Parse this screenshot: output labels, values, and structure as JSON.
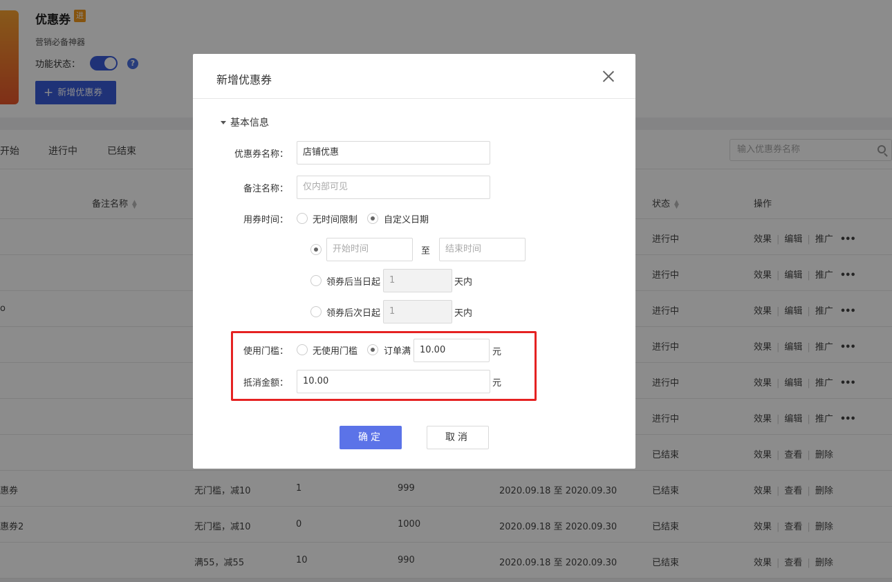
{
  "app": {
    "title": "优惠券",
    "badge": "进",
    "subtitle": "营销必备神器",
    "status_label": "功能状态：",
    "help": "?",
    "add_button": "新增优惠券"
  },
  "tabs": [
    "开始",
    "进行中",
    "已结束"
  ],
  "search": {
    "placeholder": "输入优惠券名称"
  },
  "table": {
    "headers": {
      "remark": "备注名称",
      "status": "状态",
      "ops": "操作"
    },
    "rows": [
      {
        "name": "",
        "cond": "",
        "a": "",
        "b": "",
        "period": "",
        "status": "进行中",
        "ops": [
          "效果",
          "编辑",
          "推广"
        ],
        "more": true
      },
      {
        "name": "",
        "cond": "",
        "a": "",
        "b": "",
        "period": "",
        "status": "进行中",
        "ops": [
          "效果",
          "编辑",
          "推广"
        ],
        "more": true
      },
      {
        "name": "o",
        "cond": "",
        "a": "",
        "b": "",
        "period": "",
        "status": "进行中",
        "ops": [
          "效果",
          "编辑",
          "推广"
        ],
        "more": true
      },
      {
        "name": "",
        "cond": "",
        "a": "",
        "b": "",
        "period": "",
        "status": "进行中",
        "ops": [
          "效果",
          "编辑",
          "推广"
        ],
        "more": true
      },
      {
        "name": "",
        "cond": "",
        "a": "",
        "b": "",
        "period": "",
        "status": "进行中",
        "ops": [
          "效果",
          "编辑",
          "推广"
        ],
        "more": true
      },
      {
        "name": "",
        "cond": "",
        "a": "",
        "b": "",
        "period": "",
        "status": "进行中",
        "ops": [
          "效果",
          "编辑",
          "推广"
        ],
        "more": true
      },
      {
        "name": "",
        "cond": "",
        "a": "",
        "b": "",
        "period": "",
        "status": "已结束",
        "ops": [
          "效果",
          "查看",
          "删除"
        ],
        "more": false
      },
      {
        "name": "惠券",
        "cond": "无门槛，减10",
        "a": "1",
        "b": "999",
        "period": "2020.09.18 至 2020.09.30",
        "status": "已结束",
        "ops": [
          "效果",
          "查看",
          "删除"
        ],
        "more": false
      },
      {
        "name": "惠券2",
        "cond": "无门槛，减10",
        "a": "0",
        "b": "1000",
        "period": "2020.09.18 至 2020.09.30",
        "status": "已结束",
        "ops": [
          "效果",
          "查看",
          "删除"
        ],
        "more": false
      },
      {
        "name": "",
        "cond": "满55，减55",
        "a": "10",
        "b": "990",
        "period": "2020.09.18 至 2020.09.30",
        "status": "已结束",
        "ops": [
          "效果",
          "查看",
          "删除"
        ],
        "more": false
      }
    ],
    "more_glyph": "•••"
  },
  "modal": {
    "title": "新增优惠券",
    "section": "基本信息",
    "coupon_name": {
      "label": "优惠券名称：",
      "value": "店铺优惠"
    },
    "remark": {
      "label": "备注名称：",
      "placeholder": "仅内部可见"
    },
    "time": {
      "label": "用券时间：",
      "opt_unlimited": "无时间限制",
      "opt_custom": "自定义日期",
      "start_placeholder": "开始时间",
      "to": "至",
      "end_placeholder": "结束时间",
      "opt_same_day": "领券后当日起",
      "same_day_value": "1",
      "opt_next_day": "领券后次日起",
      "next_day_value": "1",
      "days_suffix": "天内"
    },
    "threshold": {
      "label": "使用门槛：",
      "opt_none": "无使用门槛",
      "opt_order": "订单满",
      "value": "10.00",
      "unit": "元"
    },
    "discount": {
      "label": "抵消金额：",
      "value": "10.00",
      "unit": "元"
    },
    "ok": "确定",
    "cancel": "取消"
  }
}
